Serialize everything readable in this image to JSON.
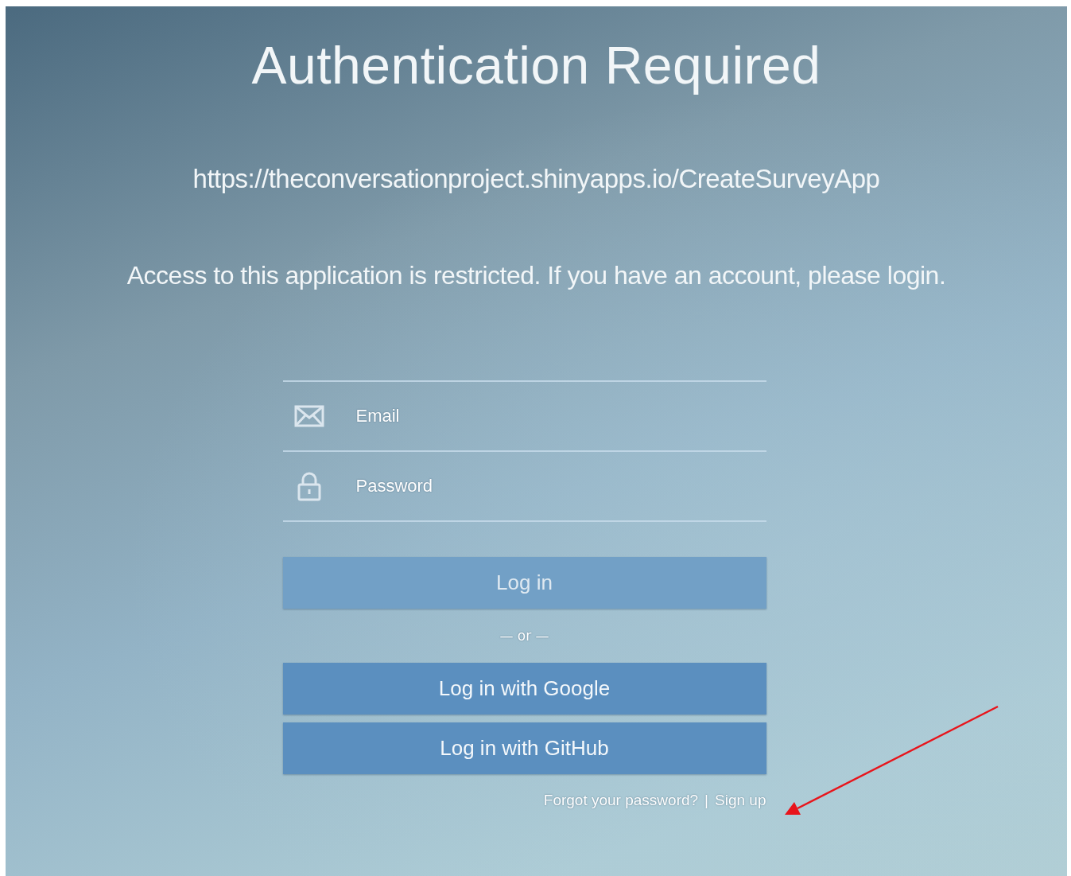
{
  "title": "Authentication Required",
  "url": "https://theconversationproject.shinyapps.io/CreateSurveyApp",
  "message": "Access to this application is restricted. If you have an account, please login.",
  "fields": [
    {
      "kind": "email",
      "placeholder": "Email"
    },
    {
      "kind": "password",
      "placeholder": "Password"
    }
  ],
  "login_button": {
    "label": "Log in",
    "disabled": true
  },
  "separator": "— or —",
  "provider_buttons": [
    {
      "label": "Log in with Google",
      "disabled": false
    },
    {
      "label": "Log in with GitHub",
      "disabled": false
    }
  ],
  "links": [
    {
      "label": "Forgot your password?"
    },
    {
      "label": "Sign up"
    }
  ],
  "link_separator": "|"
}
